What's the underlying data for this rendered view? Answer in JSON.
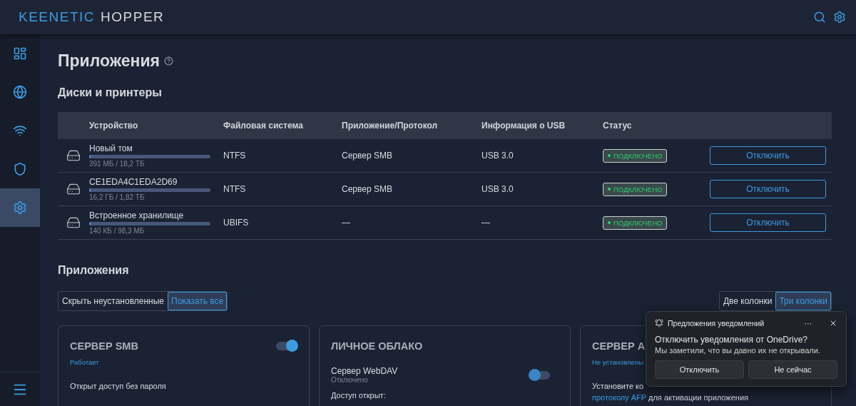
{
  "header": {
    "logo_primary": "KEENETIC",
    "logo_secondary": "HOPPER"
  },
  "sidebar": {
    "items": [
      {
        "selected": false
      },
      {
        "selected": false
      },
      {
        "selected": false
      },
      {
        "selected": false
      },
      {
        "selected": true
      }
    ]
  },
  "page": {
    "title": "Приложения"
  },
  "disks": {
    "title": "Диски и принтеры",
    "columns": [
      "Устройство",
      "Файловая система",
      "Приложение/Протокол",
      "Информация о USB",
      "Статус"
    ],
    "rows": [
      {
        "name": "Новый том",
        "usage": "391 МБ / 18,2 ТБ",
        "level": 0.01,
        "filesystem": "NTFS",
        "protocol": "Сервер SMB",
        "usb": "USB 3.0",
        "status": "ПОДКЛЮЧЕНО",
        "action": "Отключить"
      },
      {
        "name": "CE1EDA4C1EDA2D69",
        "usage": "16,2 ГБ / 1,82 ТБ",
        "level": 0.01,
        "filesystem": "NTFS",
        "protocol": "Сервер SMB",
        "usb": "USB 3.0",
        "status": "ПОДКЛЮЧЕНО",
        "action": "Отключить"
      },
      {
        "name": "Встроенное хранилище",
        "usage": "140 КБ / 98,3 МБ",
        "level": 0.01,
        "filesystem": "UBIFS",
        "protocol": "—",
        "usb": "—",
        "status": "ПОДКЛЮЧЕНО",
        "action": "Отключить"
      }
    ]
  },
  "apps": {
    "title": "Приложения",
    "filters": [
      {
        "label": "Скрыть неустановленные",
        "selected": false
      },
      {
        "label": "Показать все",
        "selected": true
      }
    ],
    "layouts": [
      {
        "label": "Две колонки",
        "selected": false
      },
      {
        "label": "Три колонки",
        "selected": true
      }
    ],
    "cards": [
      {
        "title": "СЕРВЕР SMB",
        "on": true,
        "status": "Работает",
        "items": [
          {
            "kind": "text",
            "text": "Открыт доступ без пароля"
          }
        ]
      },
      {
        "title": "ЛИЧНОЕ ОБЛАКО",
        "items": [
          {
            "kind": "switch",
            "text": "Сервер WebDAV",
            "sub": "Отключено",
            "on": false
          },
          {
            "kind": "text",
            "text": "Доступ открыт:"
          }
        ]
      },
      {
        "title": "СЕРВЕР А",
        "status": "Не установлены",
        "items": [
          {
            "kind": "text",
            "text": "Установите ко"
          },
          {
            "kind": "link",
            "link": "протоколу AFP",
            "text": "для активации приложения"
          }
        ]
      }
    ]
  },
  "notification": {
    "title": "Предложения уведомлений",
    "more": "···",
    "heading": "Отключить уведомления от OneDrive?",
    "body": "Мы заметили, что вы давно их не открывали.",
    "buttons": [
      "Отключить",
      "Не сейчас"
    ]
  }
}
